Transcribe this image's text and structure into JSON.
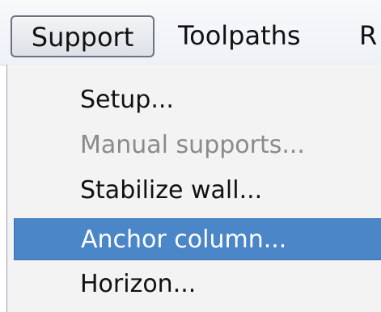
{
  "menubar": {
    "items": [
      {
        "label": "Support"
      },
      {
        "label": "Toolpaths"
      },
      {
        "label": "R"
      }
    ]
  },
  "dropdown": {
    "items": [
      {
        "label": "Setup...",
        "state": "enabled"
      },
      {
        "label": "Manual supports...",
        "state": "disabled"
      },
      {
        "label": "Stabilize wall...",
        "state": "enabled"
      },
      {
        "label": "Anchor column...",
        "state": "highlighted"
      },
      {
        "label": "Horizon...",
        "state": "enabled"
      }
    ]
  },
  "colors": {
    "highlight": "#4a86c8",
    "disabled_text": "#8a8a8a",
    "menu_background": "#f3f3f3"
  }
}
